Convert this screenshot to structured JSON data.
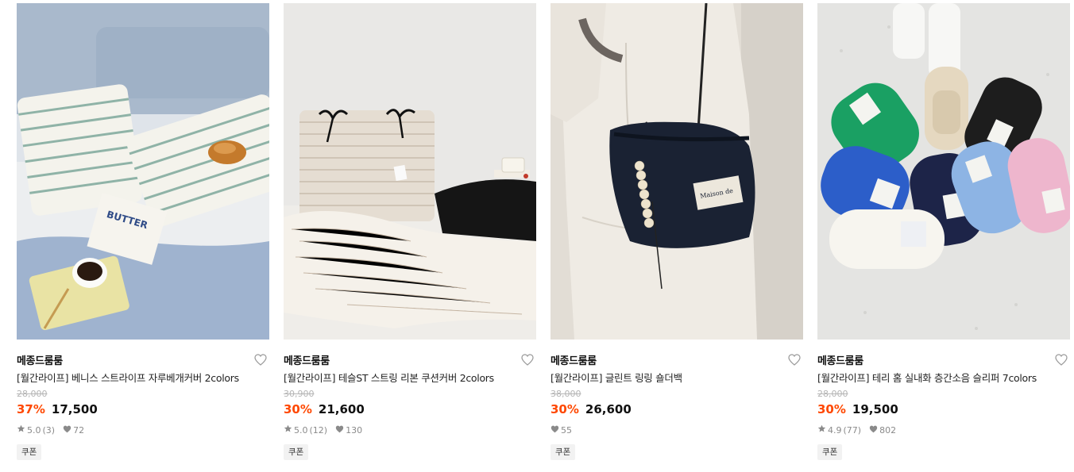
{
  "products": [
    {
      "brand": "메종드룸룸",
      "title": "[월간라이프] 베니스 스트라이프 자루베개커버 2colors",
      "original_price": "28,000",
      "discount": "37%",
      "price": "17,500",
      "rating": "5.0",
      "reviews": "(3)",
      "likes": "72",
      "coupon": "쿠폰",
      "image_text": "BUTTER"
    },
    {
      "brand": "메종드룸룸",
      "title": "[월간라이프] 테슬ST 스트링 리본 쿠션커버 2colors",
      "original_price": "30,900",
      "discount": "30%",
      "price": "21,600",
      "rating": "5.0",
      "reviews": "(12)",
      "likes": "130",
      "coupon": "쿠폰"
    },
    {
      "brand": "메종드룸룸",
      "title": "[월간라이프] 글린트 링링 숄더백",
      "original_price": "38,000",
      "discount": "30%",
      "price": "26,600",
      "likes": "55",
      "coupon": "쿠폰",
      "image_text": "Maison de"
    },
    {
      "brand": "메종드룸룸",
      "title": "[월간라이프] 테리 홈 실내화 층간소음 슬리퍼 7colors",
      "original_price": "28,000",
      "discount": "30%",
      "price": "19,500",
      "rating": "4.9",
      "reviews": "(77)",
      "likes": "802",
      "coupon": "쿠폰"
    }
  ],
  "colors": {
    "discount": "#ff4800",
    "price": "#111111",
    "muted": "#8a8a8a"
  }
}
